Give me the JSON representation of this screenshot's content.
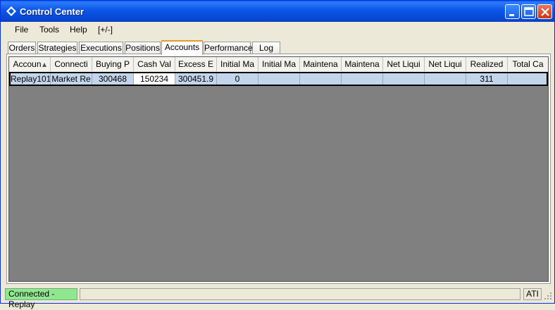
{
  "window": {
    "title": "Control Center"
  },
  "menu": [
    "File",
    "Tools",
    "Help",
    "[+/-]"
  ],
  "tabs": [
    "Orders",
    "Strategies",
    "Executions",
    "Positions",
    "Accounts",
    "Performance",
    "Log"
  ],
  "active_tab": "Accounts",
  "grid": {
    "columns": [
      "Accoun",
      "Connecti",
      "Buying P",
      "Cash Val",
      "Excess E",
      "Initial Ma",
      "Initial Ma",
      "Maintena",
      "Maintena",
      "Net Liqui",
      "Net Liqui",
      "Realized",
      "Total Ca"
    ],
    "rows": [
      [
        "Replay101",
        "Market Re",
        "300468",
        "150234",
        "300451.9",
        "0",
        "",
        "",
        "",
        "",
        "",
        "311",
        ""
      ]
    ]
  },
  "status": {
    "connection": "Connected - Replay",
    "right": "ATI"
  },
  "colors": {
    "title_bar": "#0b55e8",
    "connected": "#8fe88f",
    "selected_row": "#c3d5ea",
    "grid_bg": "#808080"
  }
}
